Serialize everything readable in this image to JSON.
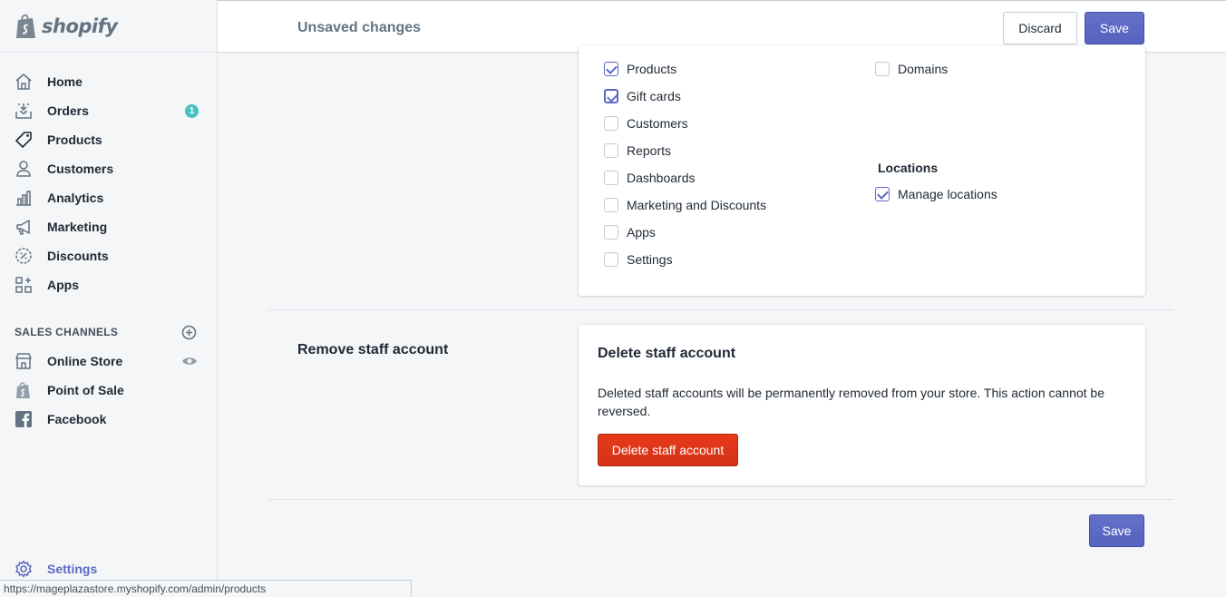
{
  "brand": {
    "name": "shopify"
  },
  "sidebar": {
    "items": [
      {
        "label": "Home",
        "icon": "home-icon"
      },
      {
        "label": "Orders",
        "icon": "orders-icon",
        "badge": "1"
      },
      {
        "label": "Products",
        "icon": "tag-icon"
      },
      {
        "label": "Customers",
        "icon": "person-icon"
      },
      {
        "label": "Analytics",
        "icon": "bar-chart-icon"
      },
      {
        "label": "Marketing",
        "icon": "megaphone-icon"
      },
      {
        "label": "Discounts",
        "icon": "discount-icon"
      },
      {
        "label": "Apps",
        "icon": "apps-icon"
      }
    ],
    "channels_heading": "SALES CHANNELS",
    "channels": [
      {
        "label": "Online Store",
        "icon": "store-icon"
      },
      {
        "label": "Point of Sale",
        "icon": "shopify-bag-icon"
      },
      {
        "label": "Facebook",
        "icon": "facebook-icon"
      }
    ],
    "settings_label": "Settings"
  },
  "topbar": {
    "title": "Unsaved changes",
    "discard_label": "Discard",
    "save_label": "Save"
  },
  "permissions": {
    "left": [
      {
        "label": "Products",
        "checked": true
      },
      {
        "label": "Gift cards",
        "checked": true
      },
      {
        "label": "Customers",
        "checked": false
      },
      {
        "label": "Reports",
        "checked": false
      },
      {
        "label": "Dashboards",
        "checked": false
      },
      {
        "label": "Marketing and Discounts",
        "checked": false
      },
      {
        "label": "Apps",
        "checked": false
      },
      {
        "label": "Settings",
        "checked": false
      }
    ],
    "right": [
      {
        "label": "Domains",
        "checked": false
      }
    ],
    "locations_heading": "Locations",
    "locations": [
      {
        "label": "Manage locations",
        "checked": true
      }
    ]
  },
  "remove_section": {
    "title": "Remove staff account",
    "card_title": "Delete staff account",
    "description": "Deleted staff accounts will be permanently removed from your store. This action cannot be reversed.",
    "delete_label": "Delete staff account"
  },
  "footer": {
    "save_label": "Save"
  },
  "status_bar": {
    "url": "https://mageplazastore.myshopify.com/admin/products"
  },
  "colors": {
    "accent": "#5c6ac4",
    "destructive": "#de3618",
    "badge": "#47c1bf",
    "background": "#f4f6f8"
  }
}
